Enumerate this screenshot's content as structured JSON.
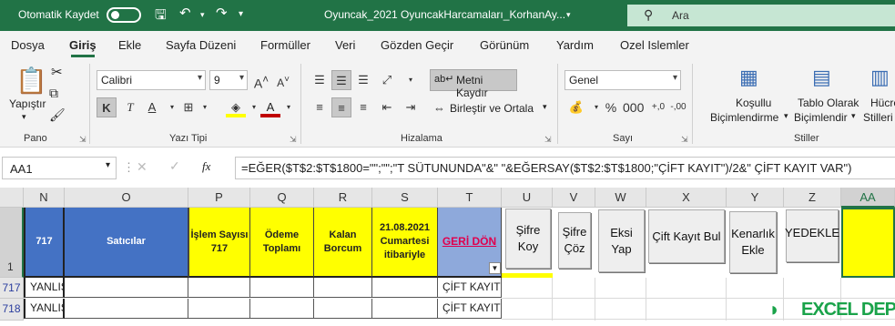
{
  "titlebar": {
    "autosave": "Otomatik Kaydet",
    "filename": "Oyuncak_2021 OyuncakHarcamaları_KorhanAy...",
    "search_placeholder": "Ara"
  },
  "tabs": [
    "Dosya",
    "Giriş",
    "Ekle",
    "Sayfa Düzeni",
    "Formüller",
    "Veri",
    "Gözden Geçir",
    "Görünüm",
    "Yardım",
    "Ozel Islemler"
  ],
  "ribbon": {
    "paste": "Yapıştır",
    "pano": "Pano",
    "font_name": "Calibri",
    "font_size": "9",
    "bold": "K",
    "italic": "T",
    "underline": "A",
    "yazi_tipi": "Yazı Tipi",
    "wrap": "Metni Kaydır",
    "merge": "Birleştir ve Ortala",
    "hizalama": "Hizalama",
    "number_format": "Genel",
    "sayi": "Sayı",
    "cond_fmt_1": "Koşullu",
    "cond_fmt_2": "Biçimlendirme",
    "table_fmt_1": "Tablo Olarak",
    "table_fmt_2": "Biçimlendir",
    "cell_styles_1": "Hücre",
    "cell_styles_2": "Stilleri",
    "stiller": "Stiller"
  },
  "formula_bar": {
    "name_box": "AA1",
    "fx": "fx",
    "formula": "=EĞER($T$2:$T$1800=\"\";\"\";\"T SÜTUNUNDA\"&\" \"&EĞERSAY($T$2:$T$1800;\"ÇİFT KAYIT\")/2&\" ÇİFT KAYIT VAR\")"
  },
  "columns": [
    "N",
    "O",
    "P",
    "Q",
    "R",
    "S",
    "T",
    "U",
    "V",
    "W",
    "X",
    "Y",
    "Z",
    "AA"
  ],
  "row_numbers": [
    "1",
    "717",
    "718"
  ],
  "header_row": {
    "n": "717",
    "o": "Satıcılar",
    "p": "İşlem Sayısı 717",
    "q": "Ödeme Toplamı",
    "r": "Kalan Borcum",
    "s": "21.08.2021 Cumartesi itibariyle",
    "t": "GERİ DÖN"
  },
  "rows": [
    {
      "n": "YANLIŞ",
      "t": "ÇİFT KAYIT"
    },
    {
      "n": "YANLIŞ",
      "t": "ÇİFT KAYIT"
    }
  ],
  "macro_buttons": {
    "sifre_koy": "Şifre Koy",
    "sifre_coz": "Şifre Çöz",
    "eksi_yap": "Eksi Yap",
    "cift_kayit_bul": "Çift Kayıt Bul",
    "kenarlik_ekle": "Kenarlık Ekle",
    "yedekle": "YEDEKLE"
  },
  "watermark": "EXCEL DEPO",
  "colors": {
    "excel_green": "#217346",
    "header_blue": "#4472c4",
    "header_yellow": "#ffff00",
    "geri_don_red": "#e0004d"
  }
}
